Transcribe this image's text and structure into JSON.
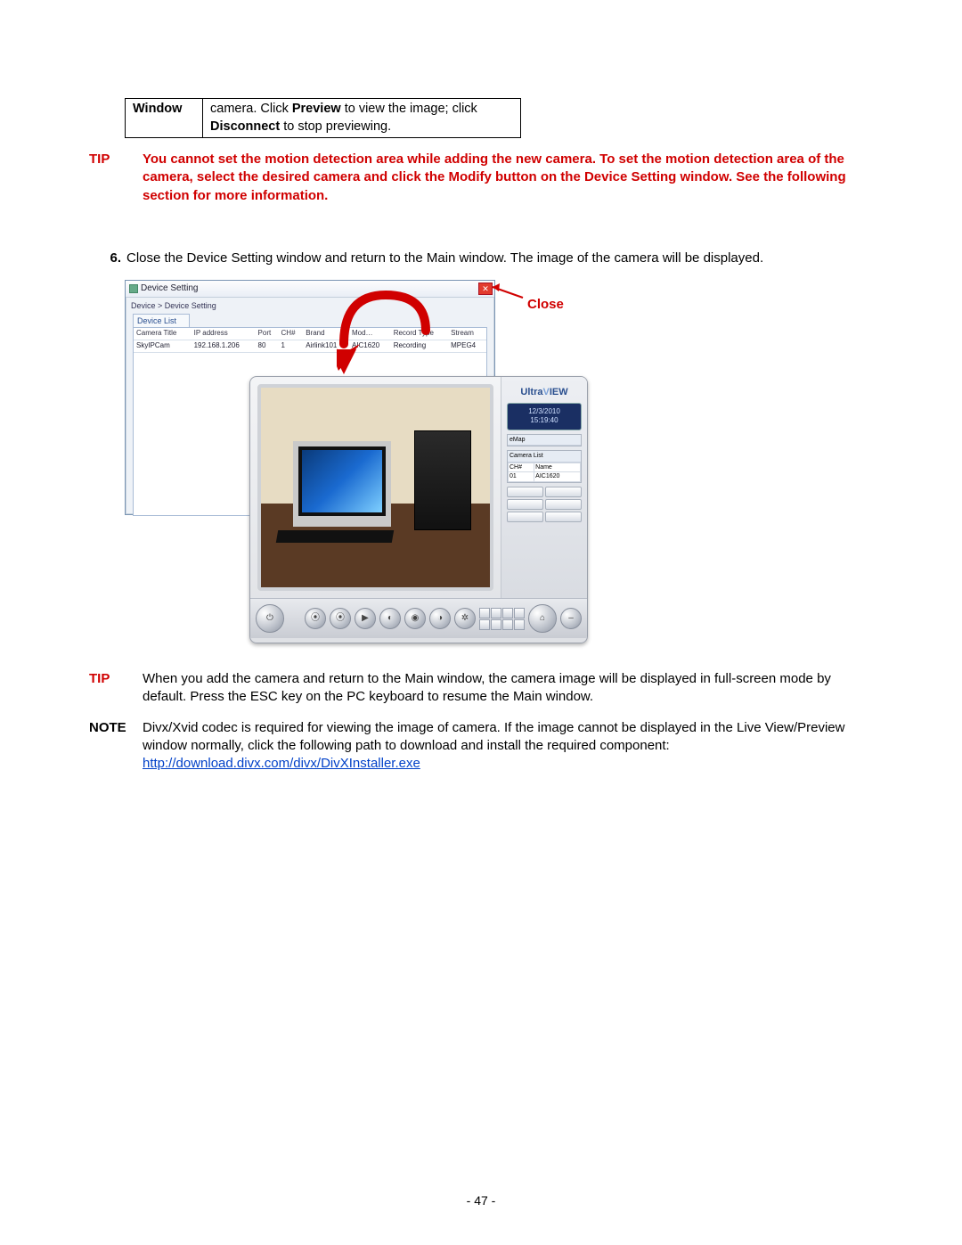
{
  "topTable": {
    "left": "Window",
    "right_pre": "camera. Click ",
    "right_b1": "Preview",
    "right_mid": " to view the image; click ",
    "right_b2": "Disconnect",
    "right_post": " to stop previewing."
  },
  "tip1_label": "TIP",
  "tip1_text": "You cannot set the motion detection area while adding the new camera. To set the motion detection area of the camera, select the desired camera and click the Modify button on the Device Setting window. See the following section for more information.",
  "step6_num": "6.",
  "step6_text": "Close the Device Setting window and return to the Main window. The image of the camera will be displayed.",
  "close_label": "Close",
  "ds": {
    "title": "Device Setting",
    "crumb": "Device > Device Setting",
    "tab": "Device List",
    "cols": [
      "Camera Title",
      "IP address",
      "Port",
      "CH#",
      "Brand",
      "Mod…",
      "Record Type",
      "Stream"
    ],
    "row": [
      "SkyIPCam",
      "192.168.1.206",
      "80",
      "1",
      "Airlink101",
      "AIC1620",
      "Recording",
      "MPEG4"
    ]
  },
  "uv": {
    "logo_a": "Ultra",
    "logo_b": "V",
    "logo_c": "IEW",
    "date": "12/3/2010",
    "time": "15:19:40",
    "eMap": "eMap",
    "camlist": "Camera List",
    "camcols": [
      "CH#",
      "Name"
    ],
    "camrow": [
      "01",
      "AIC1620"
    ]
  },
  "tip2_label": "TIP",
  "tip2_text": "When you add the camera and return to the Main window, the camera image will be displayed in full-screen mode by default. Press the ESC key on the PC keyboard to resume the Main window.",
  "note_label": "NOTE",
  "note_pre": "Divx/Xvid codec is required for viewing the image of camera. If the image cannot be displayed in the Live View/Preview window normally, click the following path to download and install the required component: ",
  "note_link": "http://download.divx.com/divx/DivXInstaller.exe",
  "pagenum": "- 47 -"
}
